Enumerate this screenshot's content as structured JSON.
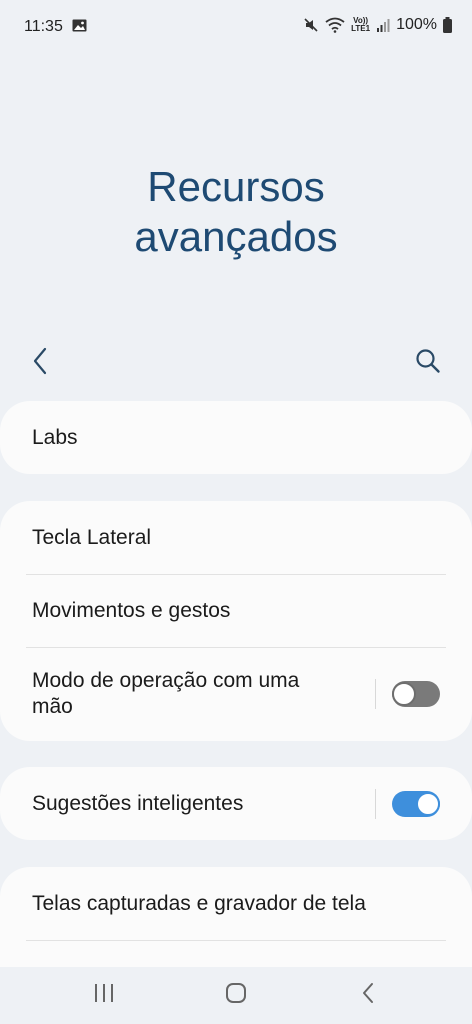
{
  "status_bar": {
    "time": "11:35",
    "lte_label_top": "Vo))",
    "lte_label_bottom": "LTE1",
    "battery": "100%"
  },
  "page": {
    "title_line1": "Recursos",
    "title_line2": "avançados"
  },
  "toolbar": {
    "back_icon": "chevron-left-icon",
    "search_icon": "search-icon"
  },
  "groups": {
    "labs": {
      "label": "Labs"
    },
    "controls": {
      "side_key": "Tecla Lateral",
      "motions": "Movimentos e gestos",
      "one_hand_line1": "Modo de operação com uma",
      "one_hand_line2": "mão",
      "one_hand_toggle": "off"
    },
    "suggestions": {
      "label": "Sugestões inteligentes",
      "toggle": "on"
    },
    "capture": {
      "label": "Telas capturadas e gravador de tela"
    }
  },
  "colors": {
    "background": "#eef1f5",
    "title": "#1e4a73",
    "accent": "#3e8fdc"
  },
  "nav_bar": {
    "recents_icon": "recents-icon",
    "home_icon": "home-icon",
    "back_icon": "back-icon"
  }
}
